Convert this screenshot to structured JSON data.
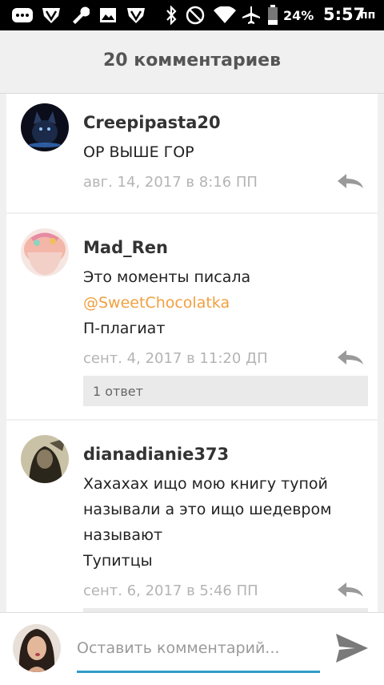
{
  "status_bar": {
    "battery_percent": "24%",
    "time": "5:57",
    "time_suffix": "пп",
    "icons": [
      "message-icon",
      "shield-icon",
      "wrench-icon",
      "image-icon",
      "shield-icon",
      "bluetooth-icon",
      "do-not-disturb-icon",
      "wifi-icon",
      "airplane-icon",
      "battery-icon"
    ]
  },
  "header": {
    "title": "20 комментариев"
  },
  "comments": [
    {
      "username": "Creepipasta20",
      "lines": [
        "ОР ВЫШЕ ГОР"
      ],
      "timestamp": "авг. 14, 2017 в 8:16 ПП"
    },
    {
      "username": "Mad_Ren",
      "lines": [
        "Это моменты писала"
      ],
      "mention": "@SweetChocolatka",
      "lines_after": [
        "П-плагиат"
      ],
      "timestamp": "сент. 4, 2017 в 11:20 ДП",
      "replies_label": "1 ответ"
    },
    {
      "username": "dianadianie373",
      "lines": [
        "Хахахах ищо мою книгу тупой",
        "называли а это ищо шедевром",
        "называют",
        "Тупитцы"
      ],
      "timestamp": "сент. 6, 2017 в 5:46 ПП"
    }
  ],
  "composer": {
    "placeholder": "Оставить комментарий..."
  },
  "colors": {
    "mention": "#f0a040",
    "accent": "#2e9bc6",
    "timestamp": "#b4b4b4"
  }
}
